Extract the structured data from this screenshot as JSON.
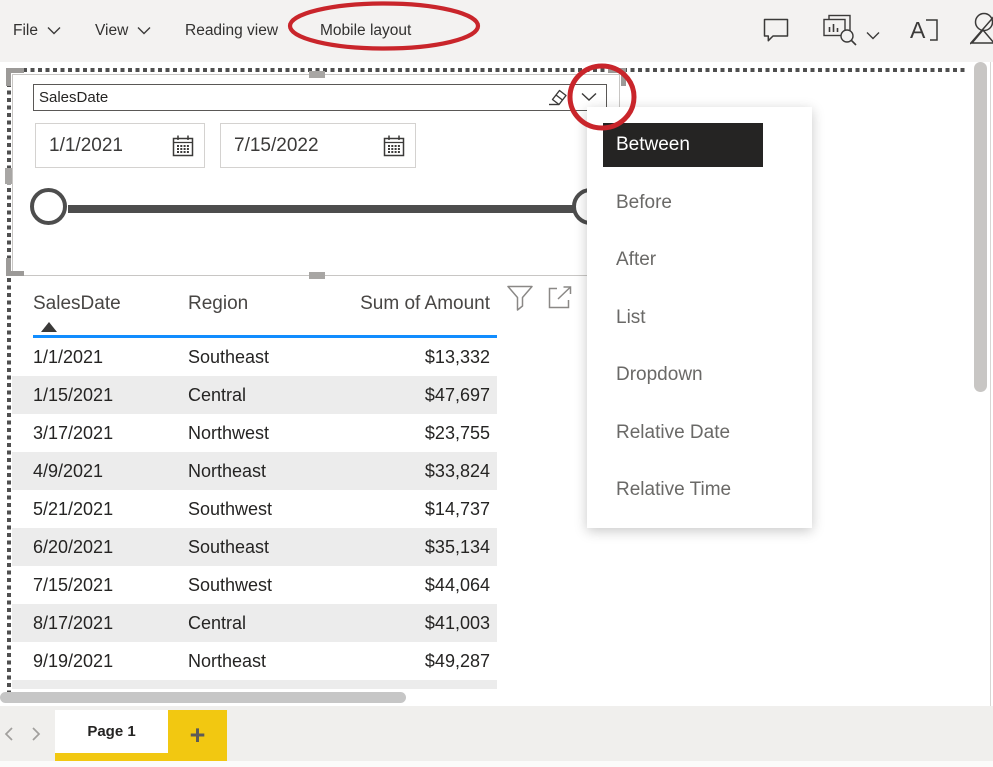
{
  "menu": {
    "file": "File",
    "view": "View",
    "reading_view": "Reading view",
    "mobile_layout": "Mobile layout"
  },
  "slicer": {
    "field": "SalesDate",
    "start_date": "1/1/2021",
    "end_date": "7/15/2022"
  },
  "slicer_menu": {
    "items": [
      {
        "label": "Between",
        "selected": true
      },
      {
        "label": "Before"
      },
      {
        "label": "After"
      },
      {
        "label": "List"
      },
      {
        "label": "Dropdown"
      },
      {
        "label": "Relative Date"
      },
      {
        "label": "Relative Time"
      }
    ]
  },
  "table": {
    "columns": {
      "date": "SalesDate",
      "region": "Region",
      "amount": "Sum of Amount"
    },
    "sort": {
      "column": "SalesDate",
      "direction": "ascending"
    },
    "rows": [
      {
        "date": "1/1/2021",
        "region": "Southeast",
        "amount": "$13,332"
      },
      {
        "date": "1/15/2021",
        "region": "Central",
        "amount": "$47,697"
      },
      {
        "date": "3/17/2021",
        "region": "Northwest",
        "amount": "$23,755"
      },
      {
        "date": "4/9/2021",
        "region": "Northeast",
        "amount": "$33,824"
      },
      {
        "date": "5/21/2021",
        "region": "Southwest",
        "amount": "$14,737"
      },
      {
        "date": "6/20/2021",
        "region": "Southeast",
        "amount": "$35,134"
      },
      {
        "date": "7/15/2021",
        "region": "Southwest",
        "amount": "$44,064"
      },
      {
        "date": "8/17/2021",
        "region": "Central",
        "amount": "$41,003"
      },
      {
        "date": "9/19/2021",
        "region": "Northeast",
        "amount": "$49,287"
      }
    ]
  },
  "pages": {
    "current": "Page 1",
    "add": "+"
  },
  "colors": {
    "accent_yellow": "#F2C811",
    "annotation_red": "#C9252B",
    "header_underline_blue": "#118DFF",
    "selected_item_bg": "#252423"
  }
}
